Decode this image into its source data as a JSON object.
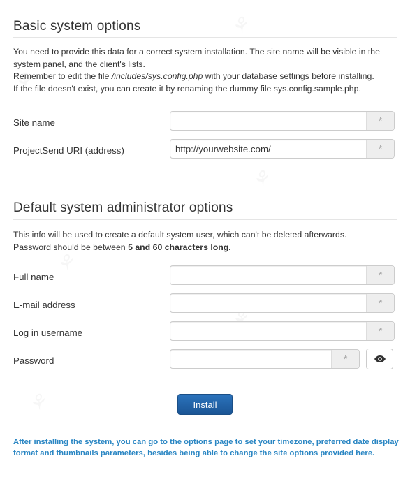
{
  "basic": {
    "title": "Basic system options",
    "intro_line1": "You need to provide this data for a correct system installation. The site name will be visible in the system panel, and the client's lists.",
    "intro_line2_before": "Remember to edit the file ",
    "intro_line2_file": "/includes/sys.config.php",
    "intro_line2_after": " with your database settings before installing.",
    "intro_line3": "If the file doesn't exist, you can create it by renaming the dummy file sys.config.sample.php.",
    "fields": {
      "site_name": {
        "label": "Site name",
        "value": "",
        "required_mark": "*"
      },
      "uri": {
        "label": "ProjectSend URI (address)",
        "value": "http://yourwebsite.com/",
        "required_mark": "*"
      }
    }
  },
  "admin": {
    "title": "Default system administrator options",
    "intro_line1": "This info will be used to create a default system user, which can't be deleted afterwards.",
    "intro_line2_before": "Password should be between ",
    "intro_line2_bold": "5 and 60 characters long.",
    "fields": {
      "full_name": {
        "label": "Full name",
        "value": "",
        "required_mark": "*"
      },
      "email": {
        "label": "E-mail address",
        "value": "",
        "required_mark": "*"
      },
      "username": {
        "label": "Log in username",
        "value": "",
        "required_mark": "*"
      },
      "password": {
        "label": "Password",
        "value": "",
        "required_mark": "*"
      }
    },
    "show_password_icon": "eye-icon"
  },
  "actions": {
    "install_label": "Install"
  },
  "footer_note": "After installing the system, you can go to the options page to set your timezone, preferred date display format and thumbnails parameters, besides being able to change the site options provided here.",
  "colors": {
    "primary_button": "#1b5595",
    "note_text": "#2a86c3"
  }
}
